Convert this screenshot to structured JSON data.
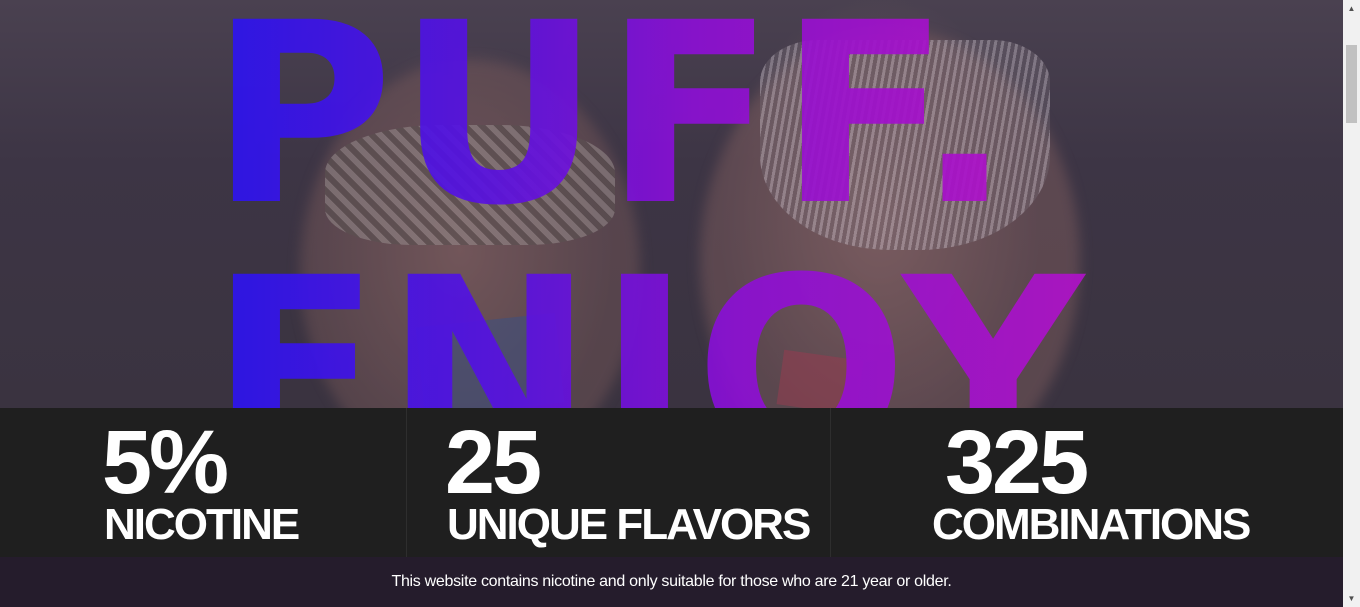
{
  "hero": {
    "line1": "PUFF.",
    "line2": "ENJOY"
  },
  "stats": [
    {
      "value": "5%",
      "label": "NICOTINE"
    },
    {
      "value": "25",
      "label": "UNIQUE FLAVORS"
    },
    {
      "value": "325",
      "label": "COMBINATIONS"
    }
  ],
  "notice": {
    "text": "This website contains nicotine and only suitable for those who are 21 year or older."
  },
  "scrollbar": {
    "up_glyph": "▲",
    "down_glyph": "▼"
  },
  "colors": {
    "gradient_start": "#2a14f0",
    "gradient_end": "#b012c8",
    "stats_background": "#1f1f1f",
    "notice_background": "#251c2c"
  }
}
